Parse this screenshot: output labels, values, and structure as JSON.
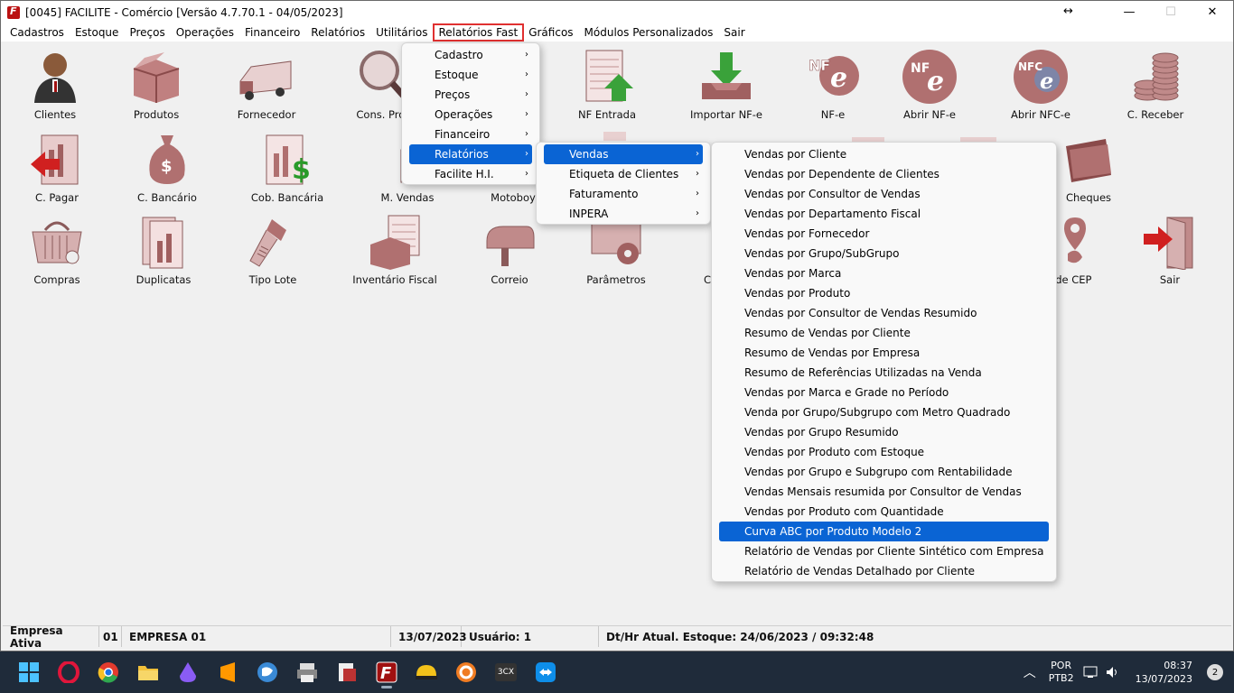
{
  "window": {
    "title": "[0045] FACILITE - Comércio [Versão 4.7.70.1 - 04/05/2023]",
    "min": "—",
    "max": "☐",
    "close": "✕",
    "resize": "↔"
  },
  "menubar": [
    "Cadastros",
    "Estoque",
    "Preços",
    "Operações",
    "Financeiro",
    "Relatórios",
    "Utilitários",
    "Relatórios Fast",
    "Gráficos",
    "Módulos Personalizados",
    "Sair"
  ],
  "icons": {
    "row1": [
      "Clientes",
      "Produtos",
      "Fornecedor",
      "Cons. Prod",
      "NF Entrada",
      "Importar NF-e",
      "NF-e",
      "Abrir NF-e",
      "Abrir NFC-e",
      "C. Receber"
    ],
    "row2": [
      "C. Pagar",
      "C. Bancário",
      "Cob. Bancária",
      "M. Vendas",
      "Motoboy",
      "Cheques"
    ],
    "row3": [
      "Compras",
      "Duplicatas",
      "Tipo Lote",
      "Inventário Fiscal",
      "Correio",
      "Parâmetros",
      "C",
      "e de CEP",
      "Sair"
    ],
    "badges": {
      "nfe": "NF",
      "nfce": "NFC"
    }
  },
  "menu1": [
    "Cadastro",
    "Estoque",
    "Preços",
    "Operações",
    "Financeiro",
    "Relatórios",
    "Facilite H.I."
  ],
  "menu2": [
    "Vendas",
    "Etiqueta de Clientes",
    "Faturamento",
    "INPERA"
  ],
  "menu3": [
    "Vendas por Cliente",
    "Vendas por Dependente de Clientes",
    "Vendas por Consultor de Vendas",
    "Vendas por Departamento Fiscal",
    "Vendas por Fornecedor",
    "Vendas por Grupo/SubGrupo",
    "Vendas por Marca",
    "Vendas por Produto",
    "Vendas por Consultor de Vendas Resumido",
    "Resumo de Vendas por Cliente",
    "Resumo de Vendas por Empresa",
    "Resumo de Referências Utilizadas na Venda",
    "Vendas por Marca e Grade no Período",
    "Venda por Grupo/Subgrupo com Metro Quadrado",
    "Vendas por Grupo Resumido",
    "Vendas por Produto com Estoque",
    "Vendas por Grupo e Subgrupo com Rentabilidade",
    "Vendas Mensais resumida por Consultor de Vendas",
    "Vendas por Produto com Quantidade",
    "Curva ABC por Produto Modelo 2",
    "Relatório de Vendas por Cliente Sintético com Empresa",
    "Relatório de Vendas Detalhado por Cliente"
  ],
  "status": {
    "empresa_label": "Empresa Ativa",
    "empresa_code": "01",
    "empresa_name": "EMPRESA 01",
    "date": "13/07/2023",
    "usuario": "Usuário: 1",
    "estoque": "Dt/Hr Atual. Estoque: 24/06/2023 / 09:32:48"
  },
  "taskbar": {
    "lang1": "POR",
    "lang2": "PTB2",
    "time": "08:37",
    "date": "13/07/2023",
    "notif": "2",
    "cx": "3CX"
  },
  "colors": {
    "accent": "#0a64d4",
    "icon": "#b07070",
    "highlight": "#e03030"
  }
}
